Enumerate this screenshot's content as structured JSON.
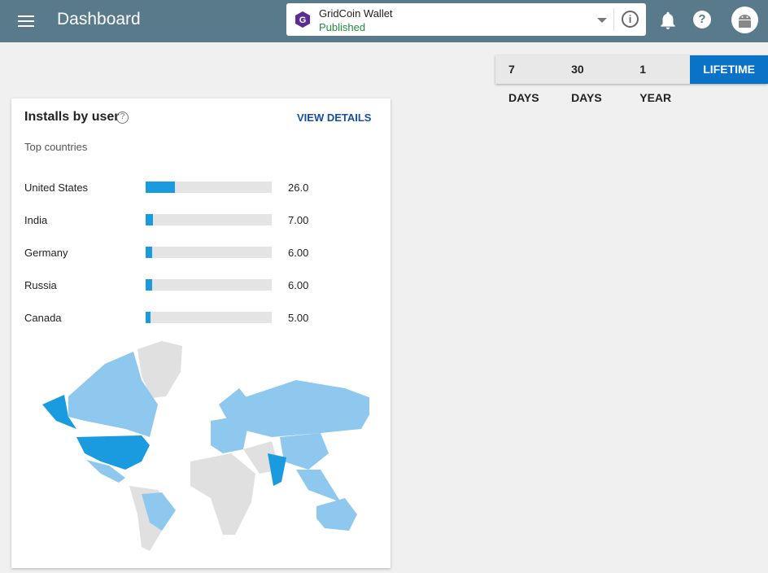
{
  "header": {
    "title": "Dashboard",
    "app_name": "GridCoin Wallet",
    "app_status": "Published",
    "help": "?"
  },
  "range": {
    "options": [
      "7 DAYS",
      "30 DAYS",
      "1 YEAR",
      "LIFETIME"
    ],
    "selected": "LIFETIME"
  },
  "card": {
    "title": "Installs by user",
    "view_details": "VIEW DETAILS",
    "subtitle": "Top countries",
    "countries": [
      {
        "name": "United States",
        "value": "26.0",
        "fraction": 0.23
      },
      {
        "name": "India",
        "value": "7.00",
        "fraction": 0.06
      },
      {
        "name": "Germany",
        "value": "6.00",
        "fraction": 0.05
      },
      {
        "name": "Russia",
        "value": "6.00",
        "fraction": 0.05
      },
      {
        "name": "Canada",
        "value": "5.00",
        "fraction": 0.04
      }
    ]
  },
  "colors": {
    "accent": "#0a73c7",
    "bar": "#1a9be0",
    "topbar": "#587a8b",
    "map_high": "#1a9be0",
    "map_low": "#8ec8ef",
    "map_none": "#e0e0e0"
  }
}
